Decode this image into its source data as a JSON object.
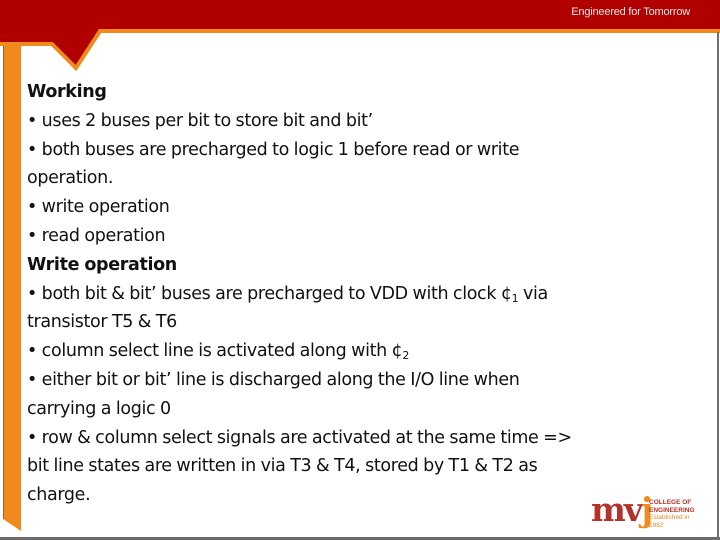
{
  "header": {
    "tagline": "Engineered for Tomorrow",
    "colors": {
      "band": "#b00000",
      "accent": "#f08a1d"
    }
  },
  "content": {
    "lines": [
      {
        "type": "heading",
        "text": "Working"
      },
      {
        "type": "bullet",
        "text": "•  uses 2 buses per bit to store bit and bit’"
      },
      {
        "type": "bullet",
        "text": "•  both buses are precharged to logic 1 before read or write"
      },
      {
        "type": "continuation",
        "text": "operation."
      },
      {
        "type": "bullet",
        "text": "•  write operation"
      },
      {
        "type": "bullet",
        "text": "• read operation"
      },
      {
        "type": "heading",
        "text": "Write operation"
      },
      {
        "type": "bullet",
        "text": "•  both bit & bit’ buses are precharged to VDD with clock ¢",
        "sub": "1",
        "after": " via"
      },
      {
        "type": "continuation",
        "text": "transistor T5 & T6"
      },
      {
        "type": "bullet",
        "text": "•  column select line is activated along with ¢",
        "sub": "2",
        "after": ""
      },
      {
        "type": "bullet",
        "text": "•  either bit or bit’ line is discharged along the I/O line when"
      },
      {
        "type": "continuation",
        "text": "carrying a  logic 0"
      },
      {
        "type": "bullet",
        "text": "•  row & column select signals are activated  at the same time =>"
      },
      {
        "type": "continuation",
        "text": "bit line  states are written in via T3 & T4, stored by T1 & T2 as"
      },
      {
        "type": "continuation",
        "text": "charge."
      }
    ]
  },
  "logo": {
    "mark_main": "mv",
    "mark_accent": "j",
    "line1": "COLLEGE OF",
    "line2": "ENGINEERING",
    "line3": "Established in 1982"
  }
}
